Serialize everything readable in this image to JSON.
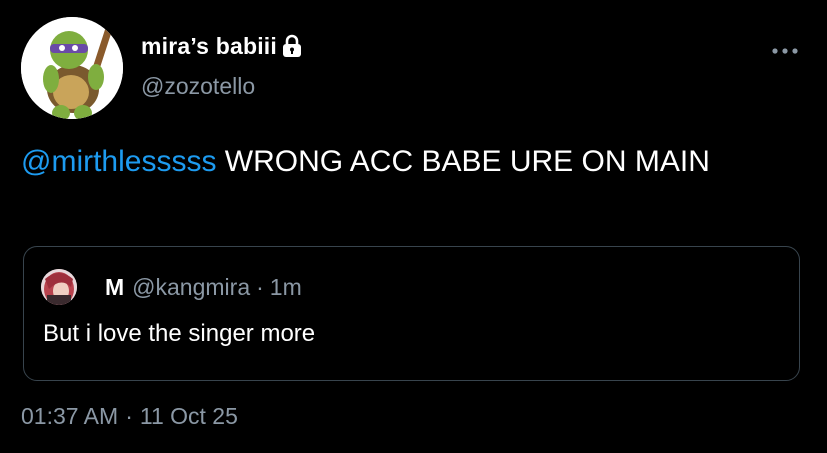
{
  "author": {
    "display_name": "mira’s babiii",
    "handle": "@zozotello",
    "avatar_icon": "turtle-character-avatar",
    "protected_icon": "lock-icon"
  },
  "more_icon": "more-dots-icon",
  "tweet": {
    "mention": "@mirthlesssss",
    "text": " WRONG ACC BABE URE ON MAIN"
  },
  "quote": {
    "avatar_icon": "pink-hair-avatar",
    "name": "M",
    "handle": "@kangmira",
    "separator": "·",
    "time": "1m",
    "text": "But i love the singer more"
  },
  "meta": {
    "time": "01:37 AM",
    "separator": "·",
    "date": "11 Oct 25"
  },
  "colors": {
    "background": "#000000",
    "link": "#1d9bf0",
    "secondary_text": "#8b98a5",
    "border": "#38444d"
  }
}
